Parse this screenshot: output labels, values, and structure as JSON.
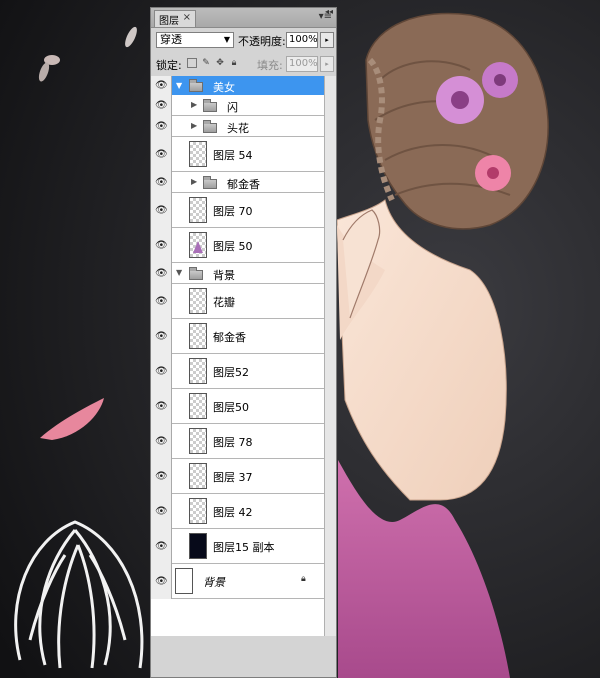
{
  "panel": {
    "tab_label": "图层",
    "close_glyph": "×",
    "blend_mode": "穿透",
    "opacity_label": "不透明度:",
    "opacity_value": "100%",
    "lock_label": "锁定:",
    "fill_label": "填充:",
    "fill_value": "100%"
  },
  "layers": [
    {
      "name": "美女",
      "kind": "group",
      "expanded": true,
      "selected": true
    },
    {
      "name": "闪",
      "kind": "group",
      "expanded": false
    },
    {
      "name": "头花",
      "kind": "group",
      "expanded": false
    },
    {
      "name": "图层 54",
      "kind": "layer"
    },
    {
      "name": "郁金香",
      "kind": "group",
      "expanded": false
    },
    {
      "name": "图层 70",
      "kind": "layer"
    },
    {
      "name": "图层 50",
      "kind": "layer"
    },
    {
      "name": "背景",
      "kind": "group",
      "expanded": true
    },
    {
      "name": "花瓣",
      "kind": "layer"
    },
    {
      "name": "郁金香",
      "kind": "layer"
    },
    {
      "name": "图层52",
      "kind": "layer"
    },
    {
      "name": "图层50",
      "kind": "layer"
    },
    {
      "name": "图层 78",
      "kind": "layer"
    },
    {
      "name": "图层 37",
      "kind": "layer"
    },
    {
      "name": "图层 42",
      "kind": "layer"
    },
    {
      "name": "图层15 副本",
      "kind": "layer",
      "thumb": "dark"
    },
    {
      "name": "背景",
      "kind": "background",
      "locked": true
    }
  ],
  "colors": {
    "selection": "#3d95ef",
    "background_dark": "#1b1b1d",
    "skin": "#f6dcc9",
    "dress": "#c2609f",
    "hair": "#8a6a56",
    "flower": "#d58fd6"
  }
}
